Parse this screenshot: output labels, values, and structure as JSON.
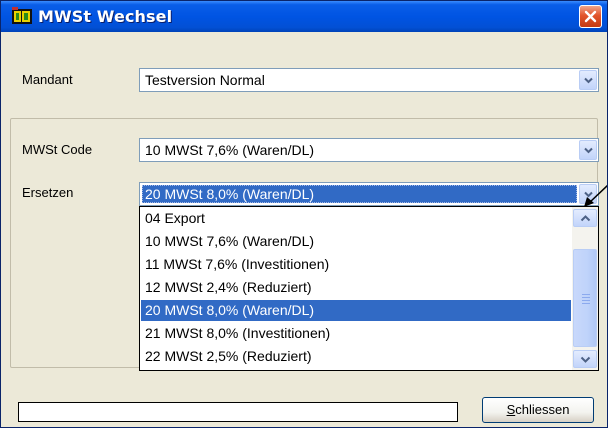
{
  "window": {
    "title": "MWSt Wechsel"
  },
  "form": {
    "mandant_label": "Mandant",
    "mandant_value": "Testversion Normal",
    "mwst_code_label": "MWSt Code",
    "mwst_code_value": "10 MWSt 7,6% (Waren/DL)",
    "ersetzen_label": "Ersetzen",
    "ersetzen_value": "20 MWSt 8,0% (Waren/DL)"
  },
  "dropdown": {
    "items": [
      "04 Export",
      "10 MWSt 7,6% (Waren/DL)",
      "11 MWSt 7,6% (Investitionen)",
      "12 MWSt 2,4% (Reduziert)",
      "20 MWSt 8,0% (Waren/DL)",
      "21 MWSt 8,0% (Investitionen)",
      "22 MWSt 2,5% (Reduziert)"
    ],
    "selected_index": 4
  },
  "footer": {
    "close_button_label": "Schliessen",
    "close_button_mnemonic": "S",
    "close_button_rest": "chliessen"
  },
  "colors": {
    "titlebar": "#0054e3",
    "selection": "#316ac5",
    "dialog_bg": "#ece9d8"
  }
}
